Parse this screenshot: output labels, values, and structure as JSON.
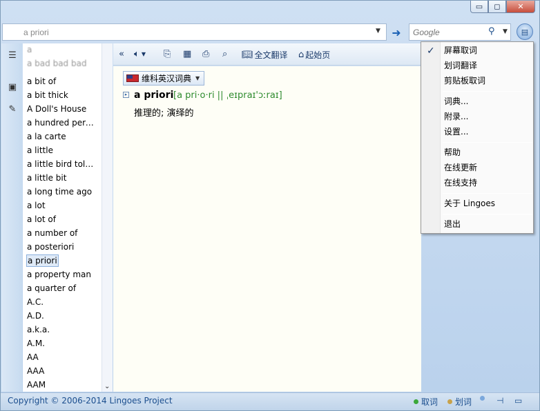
{
  "title_bar": {
    "minimize": "▭",
    "maximize": "◻",
    "close": "✕"
  },
  "search": {
    "input_value": "a priori",
    "google_placeholder": "Google"
  },
  "word_list": {
    "items": [
      "a",
      "a bad bad bad",
      "a bit of",
      "a bit thick",
      "A Doll's House",
      "a hundred perc...",
      "a la carte",
      "a little",
      "a little bird told ...",
      "a little bit",
      "a long time ago",
      "a lot",
      "a lot of",
      "a number of",
      "a posteriori",
      "a priori",
      "a property man",
      "a quarter of",
      "A.C.",
      "A.D.",
      "a.k.a.",
      "A.M.",
      "AA",
      "AAA",
      "AAM"
    ],
    "selected": "a priori"
  },
  "toolbar": {
    "back": "«",
    "full_translate": "全文翻译",
    "home": "起始页"
  },
  "dictionary": {
    "tab_name": "维科英汉词典",
    "headword": "a priori",
    "phonetic": "[a pri·o·ri || ˌeɪpraɪ'ɔːraɪ]",
    "definition": "推理的; 演绎的"
  },
  "context_menu": {
    "items": [
      {
        "label": "屏幕取词",
        "checked": true
      },
      {
        "label": "划词翻译",
        "checked": false
      },
      {
        "label": "剪贴板取词",
        "checked": false
      },
      {
        "label": "词典...",
        "checked": false
      },
      {
        "label": "附录...",
        "checked": false
      },
      {
        "label": "设置...",
        "checked": false
      },
      {
        "label": "帮助",
        "checked": false
      },
      {
        "label": "在线更新",
        "checked": false
      },
      {
        "label": "在线支持",
        "checked": false
      },
      {
        "label": "关于 Lingoes",
        "checked": false
      },
      {
        "label": "退出",
        "checked": false
      }
    ]
  },
  "status_bar": {
    "copyright": "Copyright © 2006-2014 Lingoes Project",
    "screen_capture": "取词",
    "selection": "划词"
  },
  "colors": {
    "accent": "#1b4e8e",
    "phonetic": "#2e8b2e",
    "status_on": "#3aa83a",
    "status_off": "#c8a24a"
  }
}
